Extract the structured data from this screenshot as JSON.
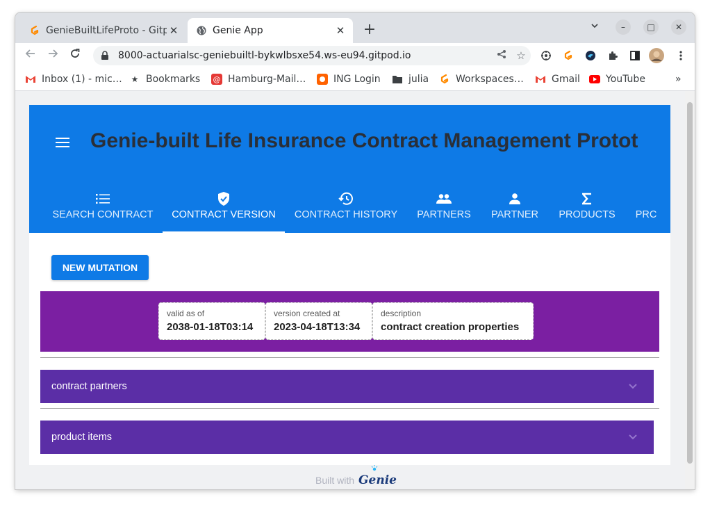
{
  "browser": {
    "tabs": [
      {
        "title": "GenieBuiltLifeProto - Gitp",
        "close": "✕",
        "active": false
      },
      {
        "title": "Genie App",
        "close": "✕",
        "active": true
      }
    ],
    "new_tab": "+",
    "window_controls": {
      "minimize": "–",
      "maximize": "□",
      "close": "✕"
    },
    "url": "8000-actuarialsc-geniebuiltl-bykwlbsxe54.ws-eu94.gitpod.io",
    "bookmarks": [
      {
        "label": "Inbox (1) - mic…",
        "icon": "gmail-icon"
      },
      {
        "label": "Bookmarks",
        "icon": "star-icon"
      },
      {
        "label": "Hamburg-Mail…",
        "icon": "at-icon"
      },
      {
        "label": "ING Login",
        "icon": "ing-icon"
      },
      {
        "label": "julia",
        "icon": "folder-icon"
      },
      {
        "label": "Workspaces…",
        "icon": "gitpod-icon"
      },
      {
        "label": "Gmail",
        "icon": "gmail-icon"
      },
      {
        "label": "YouTube",
        "icon": "youtube-icon"
      }
    ],
    "bookmarks_overflow": "»"
  },
  "app": {
    "title": "Genie-built Life Insurance Contract Management Protot",
    "nav_tabs": [
      {
        "label": "SEARCH CONTRACT",
        "icon": "list-icon",
        "active": false
      },
      {
        "label": "CONTRACT VERSION",
        "icon": "verified-shield-icon",
        "active": true
      },
      {
        "label": "CONTRACT HISTORY",
        "icon": "history-icon",
        "active": false
      },
      {
        "label": "PARTNERS",
        "icon": "people-icon",
        "active": false
      },
      {
        "label": "PARTNER",
        "icon": "person-icon",
        "active": false
      },
      {
        "label": "PRODUCTS",
        "icon": "sigma-icon",
        "active": false
      },
      {
        "label": "PRC",
        "icon": "",
        "active": false
      }
    ],
    "new_mutation_label": "NEW MUTATION",
    "version": [
      {
        "label": "valid as of",
        "value": "2038-01-18T03:14"
      },
      {
        "label": "version created at",
        "value": "2023-04-18T13:34"
      },
      {
        "label": "description",
        "value": "contract creation properties"
      }
    ],
    "sections": [
      {
        "label": "contract partners",
        "expanded": false
      },
      {
        "label": "product items",
        "expanded": false
      }
    ],
    "footer": {
      "text": "Built with",
      "logo_text": "Genie"
    }
  },
  "colors": {
    "primary": "#0e7ae6",
    "version_bar": "#7b1fa2",
    "expander": "#5b2ea6",
    "title_text": "#2a2f38"
  }
}
